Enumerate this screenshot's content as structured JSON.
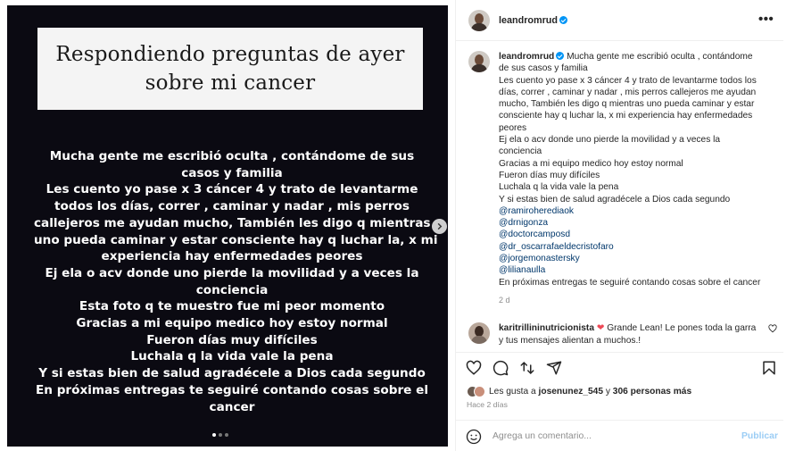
{
  "media": {
    "headline": [
      "Respondiendo preguntas de ayer",
      "sobre mi cancer"
    ],
    "story_lines": [
      "Mucha gente me escribió oculta , contándome de sus",
      "casos y familia",
      "Les cuento yo pase x 3 cáncer 4 y trato de levantarme",
      "todos los días, correr , caminar y nadar , mis perros",
      "callejeros me ayudan mucho, También les digo q mientras",
      "uno pueda caminar y estar consciente hay q luchar la, x mi",
      "experiencia hay enfermedades peores",
      "Ej ela o acv donde uno pierde la movilidad y a veces la",
      "conciencia",
      "Esta foto q te muestro fue mi peor momento",
      "Gracias a mi equipo medico hoy estoy normal",
      "Fueron días muy difíciles",
      "Luchala q la vida vale la pena",
      "Y si estas bien de salud agradécele a Dios cada segundo",
      "En próximas entregas te seguiré contando cosas sobre el",
      "cancer"
    ],
    "carousel_icon": "chevron-right-icon"
  },
  "post": {
    "username": "leandromrud",
    "more_icon": "•••",
    "caption_first": "Mucha gente me escribió oculta , contándome",
    "caption_lines": [
      "de sus casos y familia",
      "Les cuento yo pase x 3 cáncer 4 y trato de levantarme todos los",
      "días, correr , caminar y nadar , mis perros callejeros me ayudan",
      "mucho, También les digo q mientras uno pueda caminar y estar",
      "consciente hay q luchar la, x mi experiencia hay enfermedades",
      "peores",
      "Ej ela o acv donde uno pierde la movilidad y a veces la",
      "conciencia",
      "Gracias a mi equipo medico hoy estoy normal",
      "Fueron días muy difíciles",
      "Luchala q la vida vale la pena",
      "Y si estas bien de salud agradécele a Dios cada segundo"
    ],
    "mentions": [
      "@ramiroherediaok",
      "@drnigonza",
      "@doctorcamposd",
      "@dr_oscarrafaeldecristofaro",
      "@jorgemonastersky",
      "@lilianaulla"
    ],
    "caption_last": "En próximas entregas te seguiré contando cosas sobre el cancer",
    "time_ago": "2 d",
    "comment": {
      "username": "karitrillininutricionista",
      "text_after_heart": "Grande Lean! Le pones toda la garra",
      "text_line2": "y tus mensajes alientan a muchos.!"
    },
    "likes": {
      "prefix": "Les gusta a",
      "user": "josenunez_545",
      "middle": "y",
      "count": "306 personas más"
    },
    "date": "Hace 2 días",
    "add_comment_placeholder": "Agrega un comentario...",
    "publish_label": "Publicar"
  },
  "colors": {
    "verified": "#0095f6",
    "mention": "#00376b",
    "heart": "#ed4956",
    "publish": "#9bcdf5",
    "media_bg": "#0b0a12"
  }
}
